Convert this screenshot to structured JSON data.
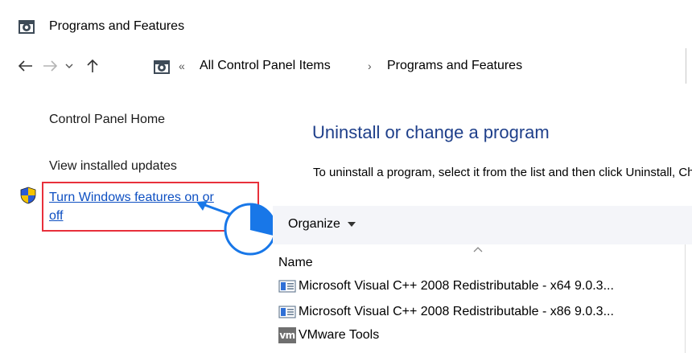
{
  "window": {
    "title": "Programs and Features",
    "icon": "control-panel-icon"
  },
  "address_bar": {
    "back_icon": "arrow-left-icon",
    "forward_icon": "arrow-right-icon",
    "recent_icon": "chevron-down-icon",
    "up_icon": "arrow-up-icon",
    "overflow": "«",
    "crumbs": [
      "All Control Panel Items",
      "Programs and Features"
    ],
    "separator": "›"
  },
  "left_pane": {
    "home": "Control Panel Home",
    "view_updates": "View installed updates",
    "features_link_line1": "Turn Windows features on or",
    "features_link_line2": "off",
    "shield_icon": "uac-shield-icon",
    "highlight_color": "#e8303b"
  },
  "main": {
    "title": "Uninstall or change a program",
    "description": "To uninstall a program, select it from the list and then click Uninstall, Change, or Repair.",
    "toolbar": {
      "organize_label": "Organize"
    },
    "column_name": "Name",
    "programs": [
      {
        "name": "Microsoft Visual C++ 2008 Redistributable - x64 9.0.3...",
        "icon": "installer-icon"
      },
      {
        "name": "Microsoft Visual C++ 2008 Redistributable - x86 9.0.3...",
        "icon": "installer-icon"
      },
      {
        "name": "VMware Tools",
        "icon": "vmware-icon",
        "icon_text": "vm"
      }
    ]
  },
  "colors": {
    "link_blue": "#0d4fc2",
    "title_blue": "#1e3f8a",
    "pointer_blue": "#1877e8",
    "toolbar_bg": "#f4f5f9"
  }
}
